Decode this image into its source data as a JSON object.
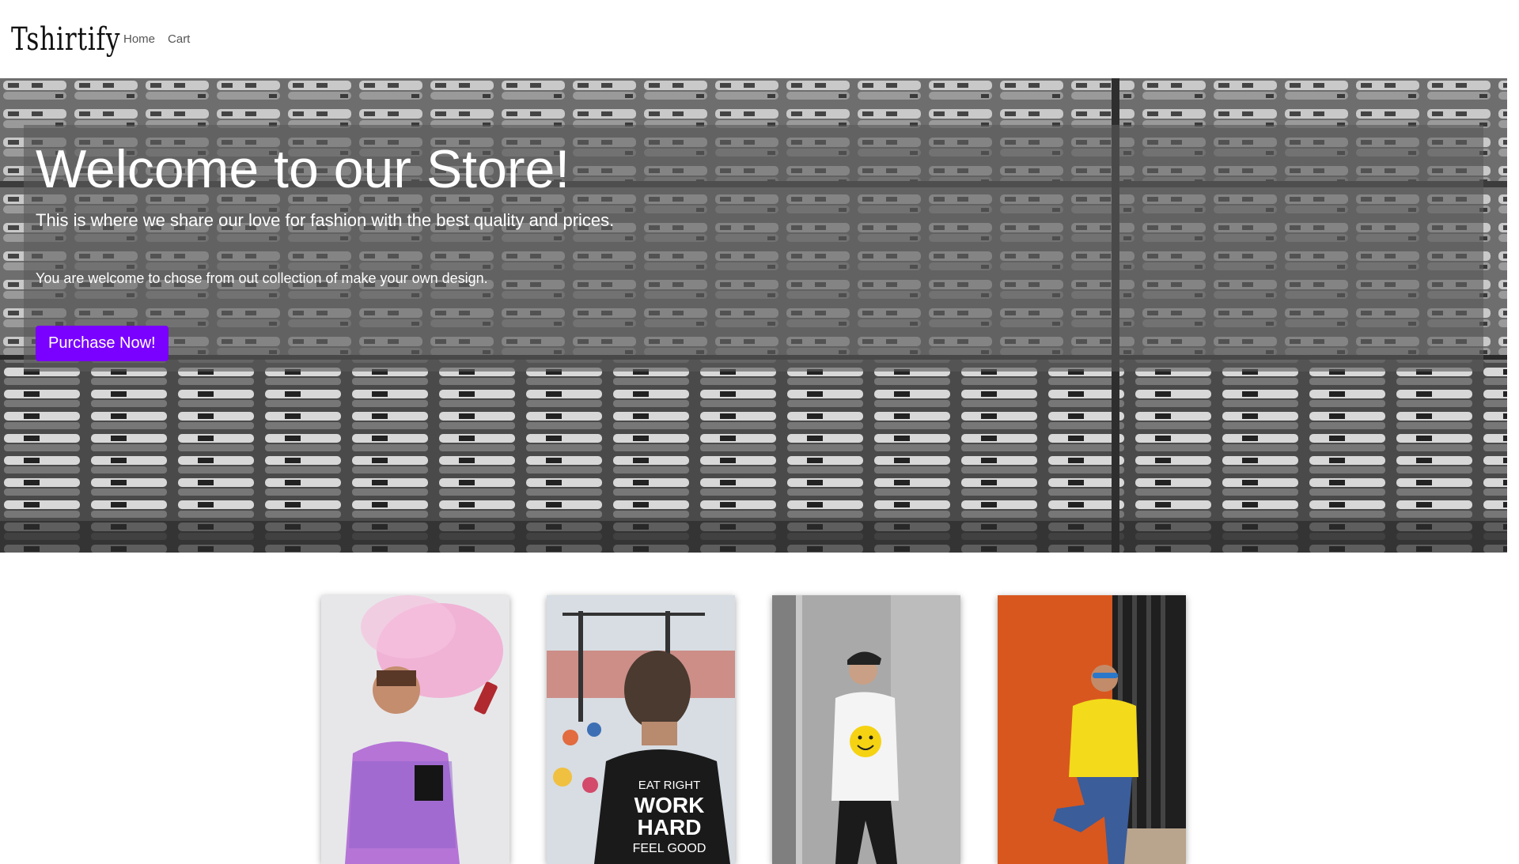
{
  "navbar": {
    "brand": "Tshirtify",
    "links": [
      "Home",
      "Cart"
    ]
  },
  "hero": {
    "title": "Welcome to our Store!",
    "lead": "This is where we share our love for fashion with the best quality and prices.",
    "subtext": "You are welcome to chose from out collection of make your own design.",
    "cta_label": "Purchase Now!",
    "accent_color": "#7a00ff"
  },
  "products": [
    {
      "image": "man-pink-smoke-patterned-shirt-photo"
    },
    {
      "image": "man-back-eat-right-work-hard-shirt-photo",
      "shirt_text": [
        "EAT RIGHT",
        "WORK",
        "HARD",
        "FEEL GOOD"
      ]
    },
    {
      "image": "man-smiley-face-white-shirt-photo"
    },
    {
      "image": "man-yellow-shirt-orange-wall-photo"
    }
  ]
}
